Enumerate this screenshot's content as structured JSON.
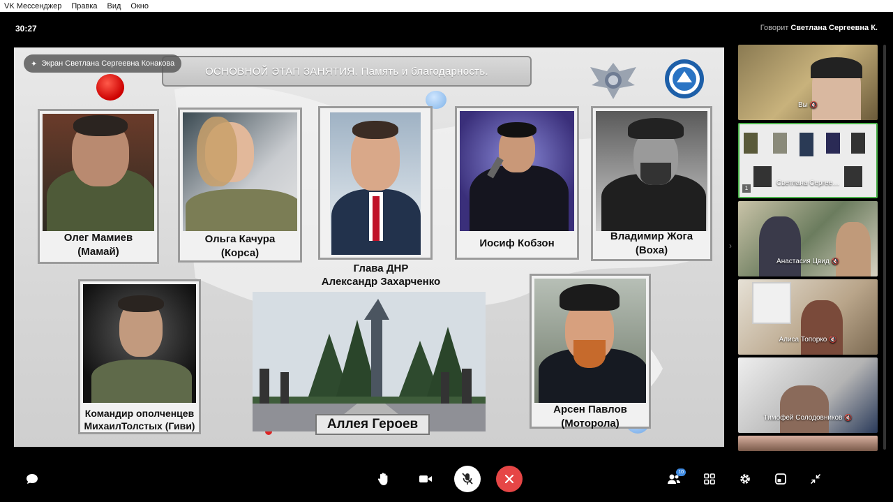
{
  "app": {
    "title": "VK Мессенджер",
    "menu": [
      "Правка",
      "Вид",
      "Окно"
    ]
  },
  "call": {
    "timer": "30:27",
    "speaker_prefix": "Говорит",
    "speaker_name": "Светлана Сергеевна К."
  },
  "screen_share": {
    "pin_label": "Экран Светлана Сергеевна Конакова",
    "slide_title": "ОСНОВНОЙ ЭТАП ЗАНЯТИЯ. Память и благодарность.",
    "cards": [
      {
        "line1": "Олег Мамиев",
        "line2": "(Мамай)"
      },
      {
        "line1": "Ольга Качура",
        "line2": "(Корса)"
      },
      {
        "line1": "Глава ДНР",
        "line2": "Александр Захарченко"
      },
      {
        "line1": "Иосиф Кобзон",
        "line2": ""
      },
      {
        "line1": "Владимир Жога",
        "line2": "(Воха)"
      },
      {
        "line1": "Командир ополченцев",
        "line2": "МихаилТолстых (Гиви)"
      },
      {
        "line1": "Арсен Павлов",
        "line2": "(Моторола)"
      }
    ],
    "alley_label": "Аллея Героев"
  },
  "participants": [
    {
      "name": "Вы"
    },
    {
      "name": "Светлана Сергее…",
      "pin_count": "1"
    },
    {
      "name": "Анастасия Цвид"
    },
    {
      "name": "Алиса Топорко"
    },
    {
      "name": "Тимофей Солодовников"
    },
    {
      "name": ""
    }
  ],
  "controls": {
    "participants_count": "10",
    "icons": [
      "chat-icon",
      "raise-hand-icon",
      "camera-icon",
      "microphone-off-icon",
      "end-call-icon",
      "participants-icon",
      "grid-icon",
      "settings-icon",
      "picture-in-picture-icon",
      "collapse-icon"
    ]
  },
  "colors": {
    "end_call": "#e64646",
    "active_tile": "#4bb34b",
    "badge": "#3f8ae0"
  }
}
